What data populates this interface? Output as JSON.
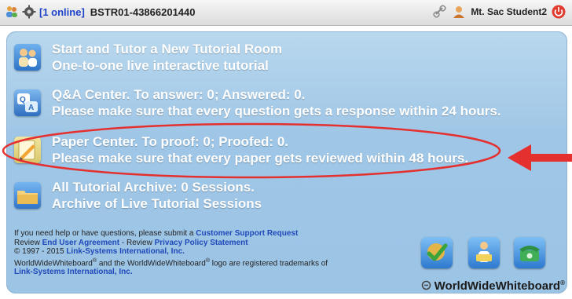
{
  "topbar": {
    "online_status": "[1 online]",
    "session_id": "BSTR01-43866201440",
    "username": "Mt. Sac Student2"
  },
  "menu": {
    "items": [
      {
        "title": "Start and Tutor a New Tutorial Room",
        "subtitle": "One-to-one live interactive tutorial"
      },
      {
        "title": "Q&A Center. To answer: 0; Answered: 0.",
        "subtitle": "Please make sure that every question gets a response within 24 hours."
      },
      {
        "title": "Paper Center. To proof: 0; Proofed: 0.",
        "subtitle": "Please make sure that every paper gets reviewed within 48 hours."
      },
      {
        "title": "All Tutorial Archive: 0 Sessions.",
        "subtitle": "Archive of Live Tutorial Sessions"
      }
    ]
  },
  "footer": {
    "help_prefix": "If you need help or have questions, please submit a",
    "support_link": "Customer Support Request",
    "review_prefix": "Review",
    "eula_link": "End User Agreement",
    "review_mid": "- Review",
    "privacy_link": "Privacy Policy Statement",
    "copyright_prefix": "© 1997 - 2015",
    "company_link": "Link-Systems International, Inc.",
    "trademark_a": "WorldWideWhiteboard",
    "trademark_b": "and the WorldWideWhiteboard",
    "trademark_c": "logo are registered trademarks of",
    "company_link2": "Link-Systems International, Inc.",
    "reg_mark": "®"
  },
  "brand": {
    "name": "WorldWideWhiteboard",
    "mark": "®"
  },
  "annotation": {
    "color": "#e53030"
  }
}
